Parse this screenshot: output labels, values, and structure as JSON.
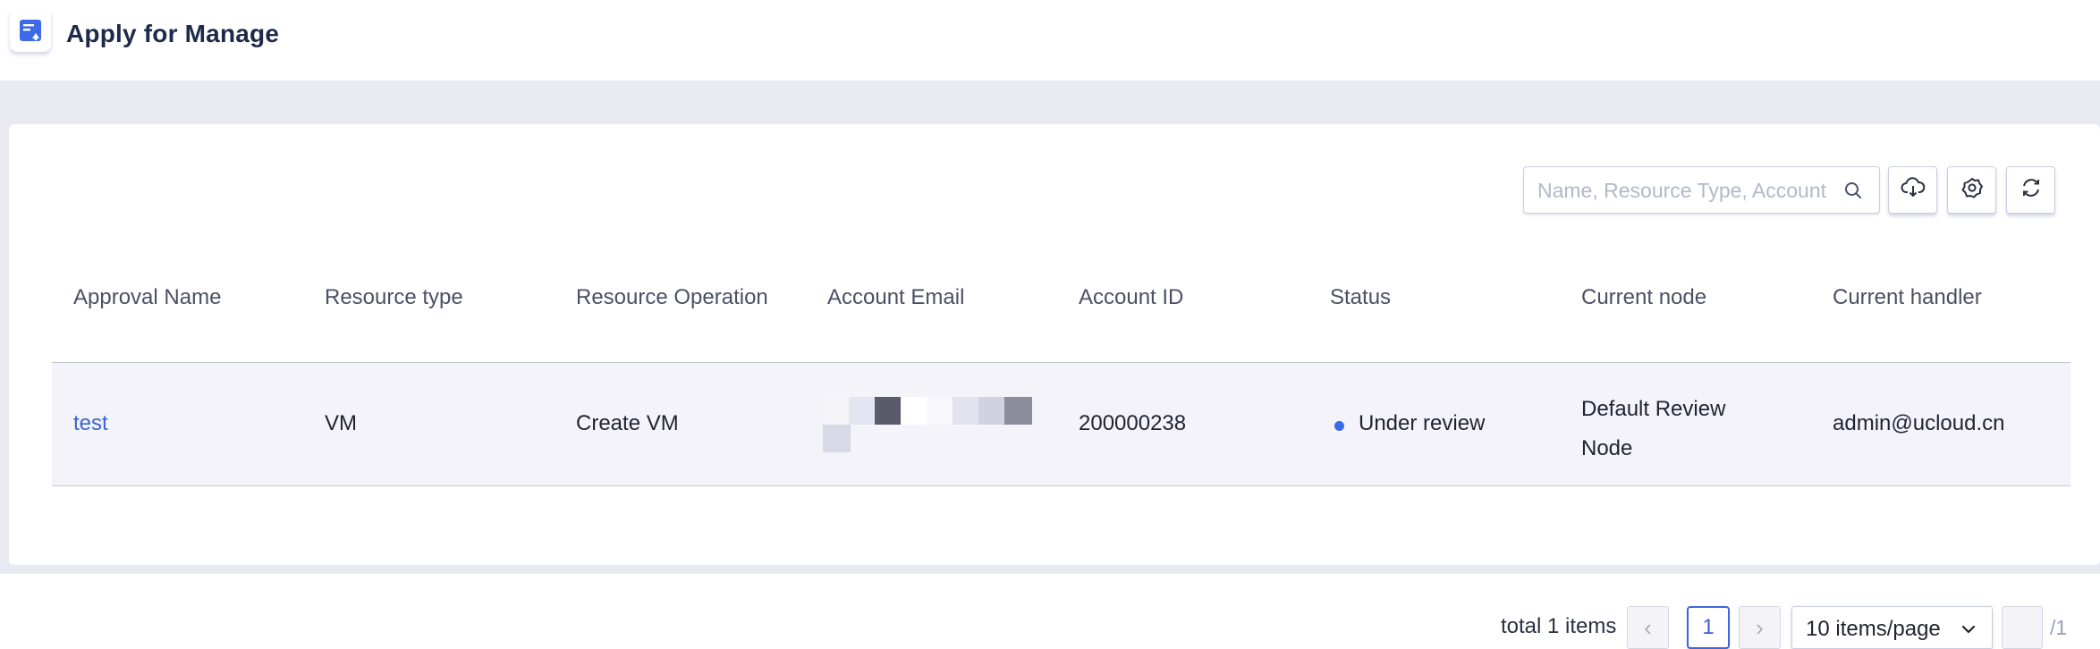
{
  "header": {
    "title": "Apply for Manage",
    "icon": "apply-document-icon",
    "accent_color": "#3d6be8"
  },
  "toolbar": {
    "search_placeholder": "Name, Resource Type, Account",
    "search_icon": "search-icon",
    "download_icon": "cloud-download-icon",
    "settings_icon": "gear-icon",
    "refresh_icon": "refresh-icon"
  },
  "table": {
    "columns": [
      "Approval Name",
      "Resource type",
      "Resource Operation",
      "Account Email",
      "Account ID",
      "Status",
      "Current node",
      "Current handler"
    ],
    "rows": [
      {
        "approval_name": "test",
        "resource_type": "VM",
        "resource_operation": "Create VM",
        "account_email_redacted": true,
        "account_id": "200000238",
        "status": "Under review",
        "status_color": "#3d6be8",
        "current_node": "Default Review Node",
        "current_handler": "admin@ucloud.cn"
      }
    ]
  },
  "pagination": {
    "total_text": "total 1 items",
    "prev_glyph": "‹",
    "next_glyph": "›",
    "current_page": "1",
    "page_size_label": "10 items/page",
    "page_count_text": "/1"
  }
}
